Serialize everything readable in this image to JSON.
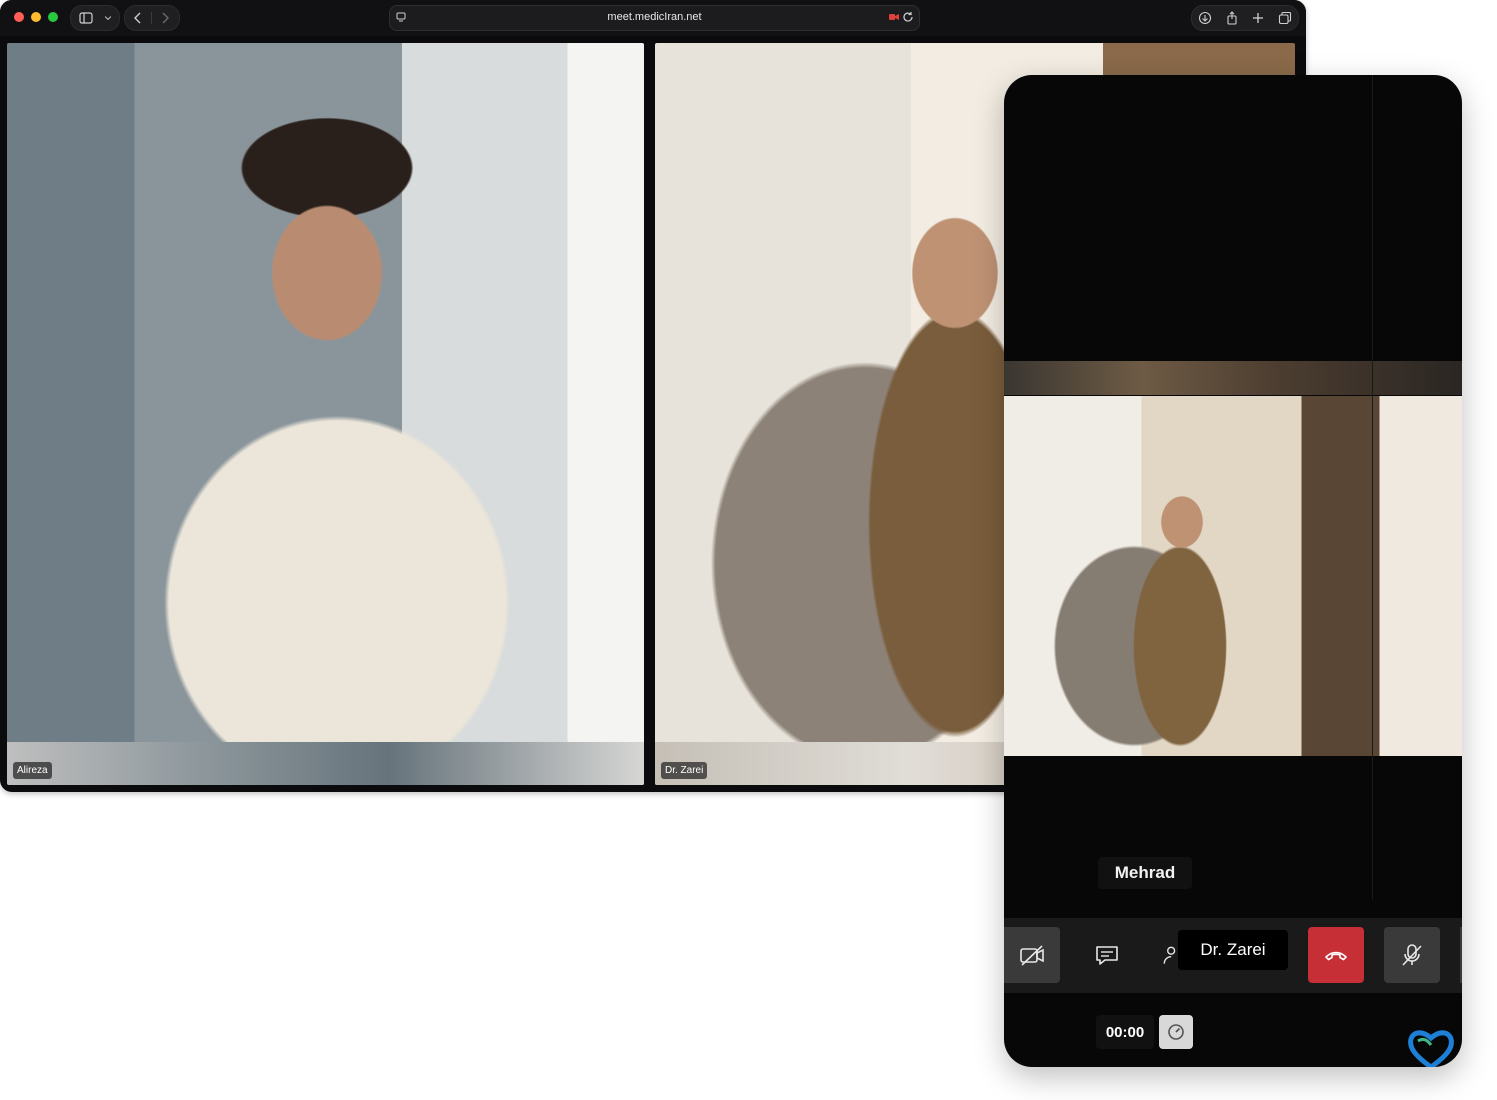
{
  "browser": {
    "url": "meet.medicIran.net",
    "toolbar_icons": [
      "sidebar-icon",
      "chevron-down-icon",
      "back-icon",
      "forward-icon",
      "site-settings-icon",
      "camera-recording-icon",
      "reload-icon",
      "download-icon",
      "share-icon",
      "new-tab-icon",
      "tabs-overview-icon"
    ]
  },
  "tiles": [
    {
      "name": "Alireza"
    },
    {
      "name": "Dr. Zarei"
    }
  ],
  "phone": {
    "participant_name": "Mehrad",
    "tooltip": "Dr. Zarei",
    "timer": "00:00",
    "controls": [
      "camera-off-icon",
      "chat-icon",
      "participants-icon",
      "hang-up-icon",
      "mic-off-icon"
    ],
    "colors": {
      "hangup": "#c62f36",
      "control_bg": "#3a3a3a",
      "bar_bg": "#1a1a1a"
    }
  }
}
